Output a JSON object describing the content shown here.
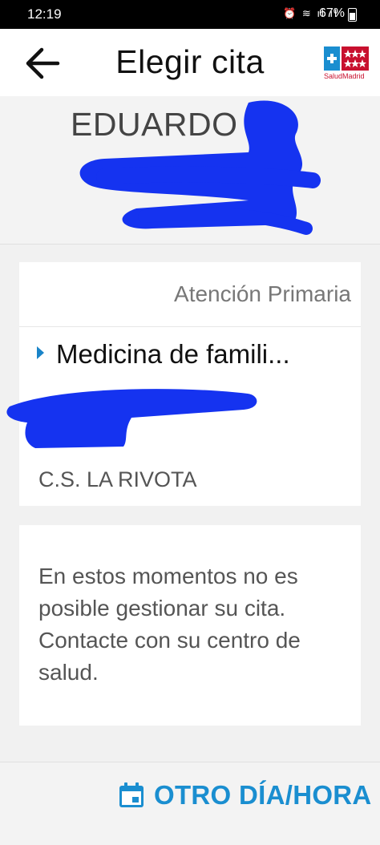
{
  "status_bar": {
    "time": "12:19",
    "battery": "67%"
  },
  "app_bar": {
    "title": "Elegir cita",
    "logo_text": "SaludMadrid"
  },
  "patient": {
    "first_name": "EDUARDO"
  },
  "appointment": {
    "specialty": "Atención Primaria",
    "service": "Medicina de famili...",
    "center": "C.S. LA RIVOTA"
  },
  "notice": {
    "message": "En estos momentos no es posible gestionar su cita. Contacte con su centro de salud."
  },
  "actions": {
    "other_day_label": "OTRO DÍA/HORA"
  },
  "colors": {
    "accent": "#1a8ed0",
    "redaction": "#1533f0",
    "brand_red": "#c8102e"
  }
}
